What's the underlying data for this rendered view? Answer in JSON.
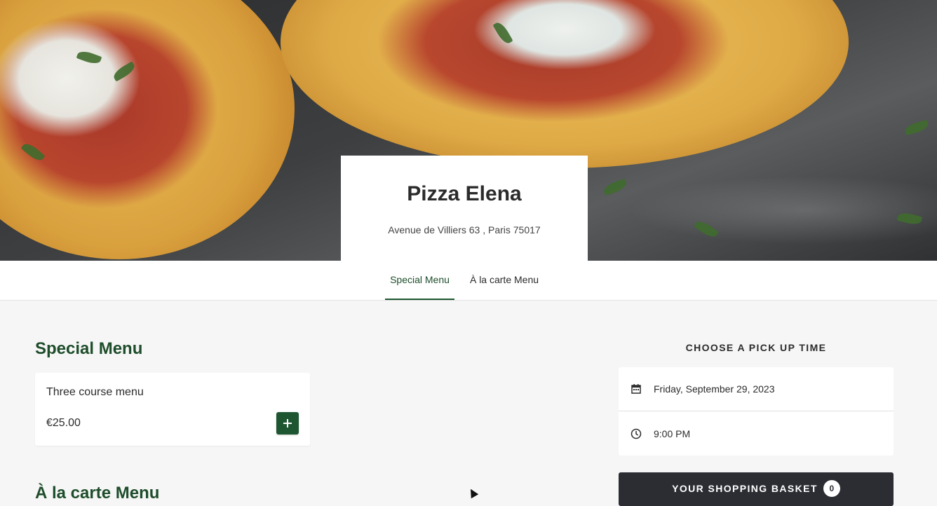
{
  "restaurant": {
    "name": "Pizza Elena",
    "address": "Avenue de Villiers 63 , Paris 75017"
  },
  "tabs": [
    {
      "label": "Special Menu",
      "active": true
    },
    {
      "label": "À la carte Menu",
      "active": false
    }
  ],
  "special_menu": {
    "title": "Special Menu",
    "items": [
      {
        "name": "Three course menu",
        "price": "€25.00"
      }
    ]
  },
  "alacarte_menu": {
    "title": "À la carte Menu"
  },
  "pickup": {
    "title": "CHOOSE A PICK UP TIME",
    "date": "Friday, September 29, 2023",
    "time": "9:00 PM"
  },
  "basket": {
    "label": "YOUR SHOPPING BASKET",
    "count": "0"
  },
  "colors": {
    "brand_green": "#1e5631",
    "basket_dark": "#2b2d33",
    "page_bg": "#f6f6f6"
  }
}
